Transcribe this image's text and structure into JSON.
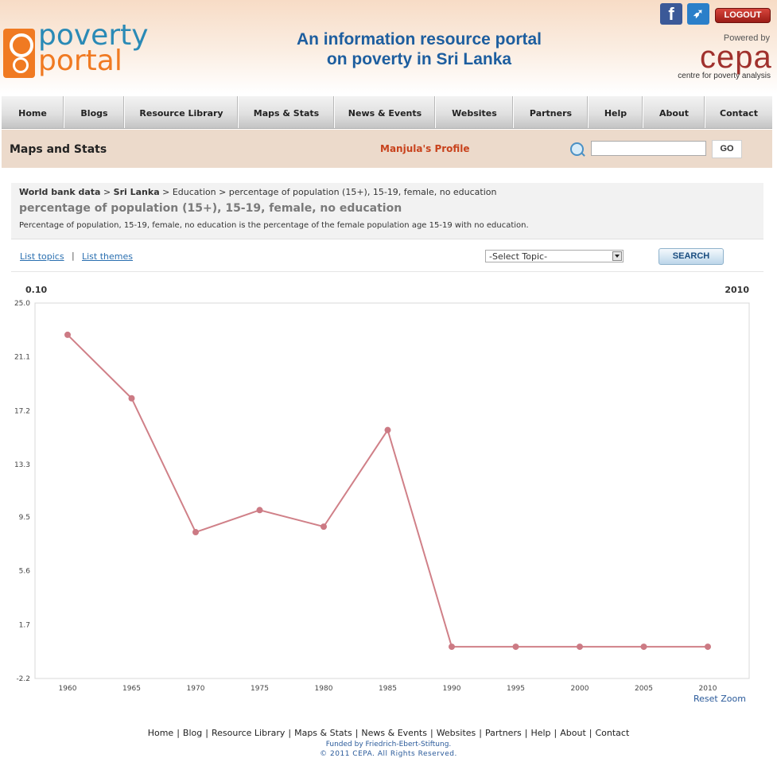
{
  "header": {
    "logo_line1": "poverty",
    "logo_line2": "portal",
    "tagline_line1": "An information resource portal",
    "tagline_line2": "on poverty in Sri Lanka",
    "logout_label": "LOGOUT",
    "powered_by": "Powered by",
    "partner_logo": "cepa",
    "partner_name": "centre for poverty analysis",
    "social_icons": [
      "facebook-icon",
      "twitter-icon"
    ]
  },
  "nav": {
    "items": [
      {
        "label": "Home"
      },
      {
        "label": "Blogs"
      },
      {
        "label": "Resource Library"
      },
      {
        "label": "Maps & Stats"
      },
      {
        "label": "News & Events"
      },
      {
        "label": "Websites"
      },
      {
        "label": "Partners"
      },
      {
        "label": "Help"
      },
      {
        "label": "About"
      },
      {
        "label": "Contact"
      }
    ]
  },
  "subbar": {
    "section_title": "Maps and Stats",
    "profile_link": "Manjula's Profile",
    "search_placeholder": "",
    "go_label": "GO"
  },
  "breadcrumb": {
    "part1": "World bank data",
    "sep1": " > ",
    "part2": "Sri Lanka",
    "rest": " > Education > percentage of population (15+), 15-19, female, no education"
  },
  "indicator": {
    "title": "percentage of population (15+), 15-19, female, no education",
    "description": "Percentage of population, 15-19, female, no education is the percentage of the female population age 15-19 with no education."
  },
  "controls": {
    "list_topics": "List topics",
    "separator": "|",
    "list_themes": "List themes",
    "select_value": "-Select Topic-",
    "search_label": "SEARCH"
  },
  "chart": {
    "top_left_label": "0.10",
    "top_right_label": "2010",
    "reset_zoom": "Reset Zoom",
    "line_color": "#d08088",
    "marker_color": "#cc7a84"
  },
  "chart_data": {
    "type": "line",
    "x": [
      "1960",
      "1965",
      "1970",
      "1975",
      "1980",
      "1985",
      "1990",
      "1995",
      "2000",
      "2005",
      "2010"
    ],
    "series": [
      {
        "values": [
          22.7,
          18.1,
          8.4,
          10.0,
          8.8,
          15.8,
          0.1,
          0.1,
          0.1,
          0.1,
          0.1
        ]
      }
    ],
    "y_ticks": [
      "25.0",
      "21.1",
      "17.2",
      "13.3",
      "9.5",
      "5.6",
      "1.7",
      "-2.2"
    ],
    "ylim": [
      -2.2,
      25.0
    ],
    "title": "",
    "xlabel": "",
    "ylabel": "",
    "grid": false,
    "legend": "none"
  },
  "footer": {
    "links": [
      "Home",
      "Blog",
      "Resource Library",
      "Maps & Stats",
      "News & Events",
      "Websites",
      "Partners",
      "Help",
      "About",
      "Contact"
    ],
    "link_separator": "|",
    "funded_by": "Funded by Friedrich-Ebert-Stiftung.",
    "copyright": "© 2011 CEPA. All Rights Reserved."
  }
}
